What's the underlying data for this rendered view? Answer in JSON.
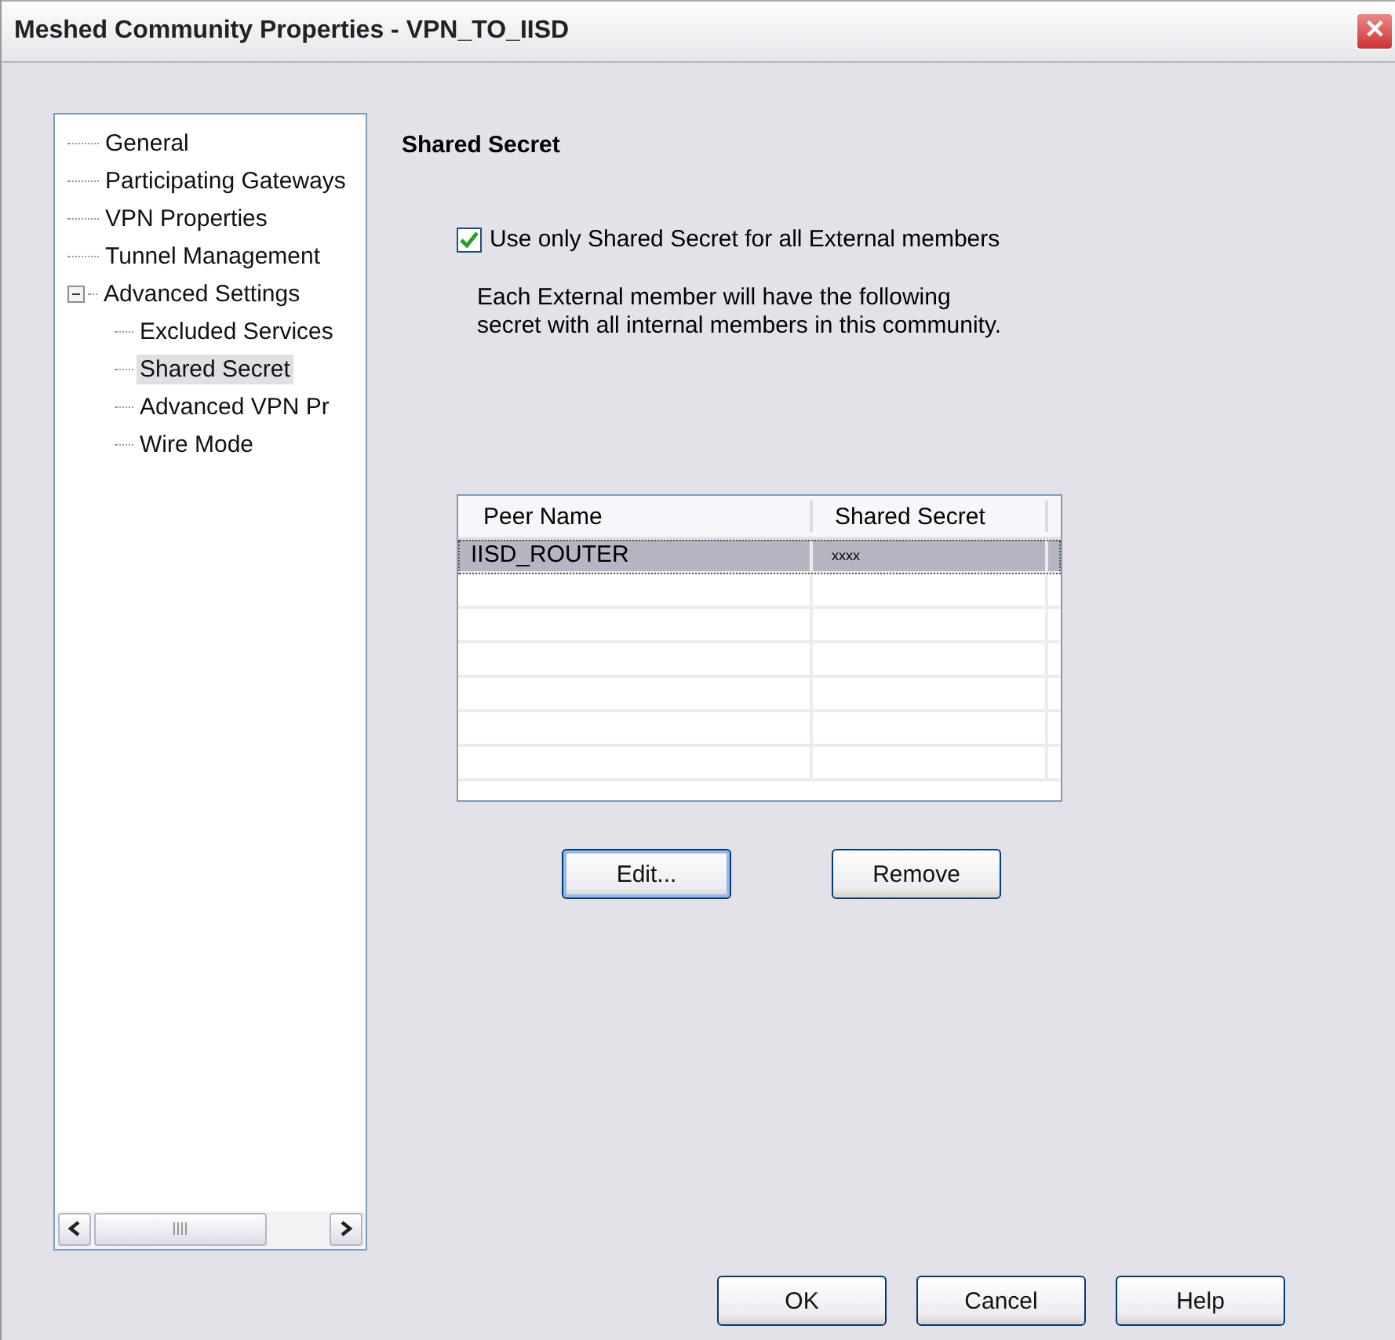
{
  "window": {
    "title": "Meshed Community Properties - VPN_TO_IISD",
    "close": "✕"
  },
  "tree": {
    "items": [
      {
        "label": "General",
        "selected": false
      },
      {
        "label": "Participating Gateways",
        "selected": false
      },
      {
        "label": "VPN Properties",
        "selected": false
      },
      {
        "label": "Tunnel Management",
        "selected": false
      },
      {
        "label": "Advanced Settings",
        "selected": false,
        "expanded": true,
        "children": [
          {
            "label": "Excluded Services",
            "selected": false
          },
          {
            "label": "Shared Secret",
            "selected": true
          },
          {
            "label": "Advanced VPN Pr",
            "selected": false
          },
          {
            "label": "Wire Mode",
            "selected": false
          }
        ]
      }
    ]
  },
  "page": {
    "heading": "Shared Secret",
    "checkbox": {
      "label": "Use only Shared Secret for all External members",
      "checked": true
    },
    "description": "Each External member will have the following secret with all internal members in this community.",
    "table": {
      "columns": [
        "Peer Name",
        "Shared Secret"
      ],
      "rows": [
        {
          "cells": [
            "IISD_ROUTER",
            "xxxx"
          ],
          "selected": true
        }
      ]
    },
    "buttons": [
      "Edit...",
      "Remove"
    ]
  },
  "footer_buttons": [
    "OK",
    "Cancel",
    "Help"
  ]
}
